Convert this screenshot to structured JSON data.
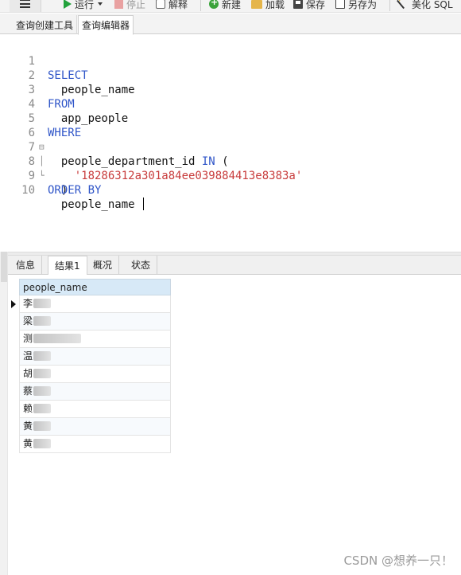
{
  "toolbar": {
    "run_label": "运行",
    "stop_label": "停止",
    "explain_label": "解释",
    "new_label": "新建",
    "load_label": "加载",
    "save_label": "保存",
    "saveas_label": "另存为",
    "beautify_label": "美化 SQL"
  },
  "tabs": [
    {
      "label": "查询创建工具"
    },
    {
      "label": "查询编辑器"
    }
  ],
  "editor": {
    "lines": [
      {
        "num": "1",
        "kw": "SELECT"
      },
      {
        "num": "2",
        "id": "  people_name"
      },
      {
        "num": "3",
        "kw": "FROM"
      },
      {
        "num": "4",
        "id": "  app_people"
      },
      {
        "num": "5",
        "kw": "WHERE"
      },
      {
        "num": "6",
        "id": "  people_department_id ",
        "kw2": "IN",
        "id2": " ("
      },
      {
        "num": "7",
        "str": "    '18286312a301a84ee039884413e8383a'"
      },
      {
        "num": "8",
        "id": "  )"
      },
      {
        "num": "9",
        "kw": "ORDER BY"
      },
      {
        "num": "10",
        "id": "  people_name "
      }
    ]
  },
  "result_tabs": [
    {
      "label": "信息"
    },
    {
      "label": "结果1"
    },
    {
      "label": "概况"
    },
    {
      "label": "状态"
    }
  ],
  "grid": {
    "column": "people_name",
    "rows": [
      "李",
      "梁",
      "测",
      "温",
      "胡",
      "蔡",
      "赖",
      "黄",
      "黄"
    ]
  },
  "watermark": "CSDN @想养一只！"
}
